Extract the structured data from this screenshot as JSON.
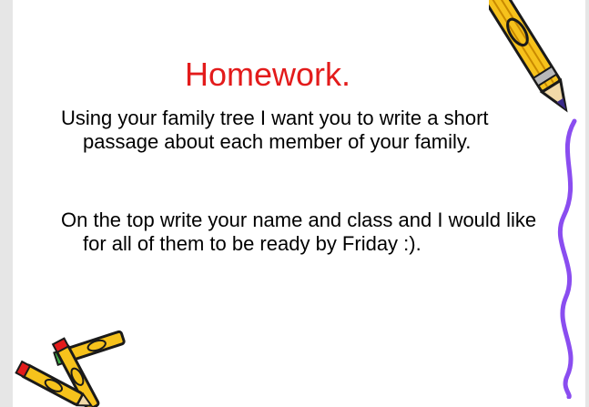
{
  "slide": {
    "title": "Homework.",
    "paragraphs": [
      "Using your family tree I want you to write a short passage about each member of your family.",
      "On the top write your name and class and I would like for all of them to be ready by Friday :)."
    ]
  },
  "colors": {
    "title": "#e31b1b",
    "text": "#000000",
    "background": "#ffffff",
    "squiggle": "#8a4df0",
    "pencil_body": "#f6c21c",
    "pencil_outline": "#1a1a1a"
  },
  "icons": [
    "pencil-icon",
    "squiggle-line",
    "crossed-pencils-icon"
  ]
}
